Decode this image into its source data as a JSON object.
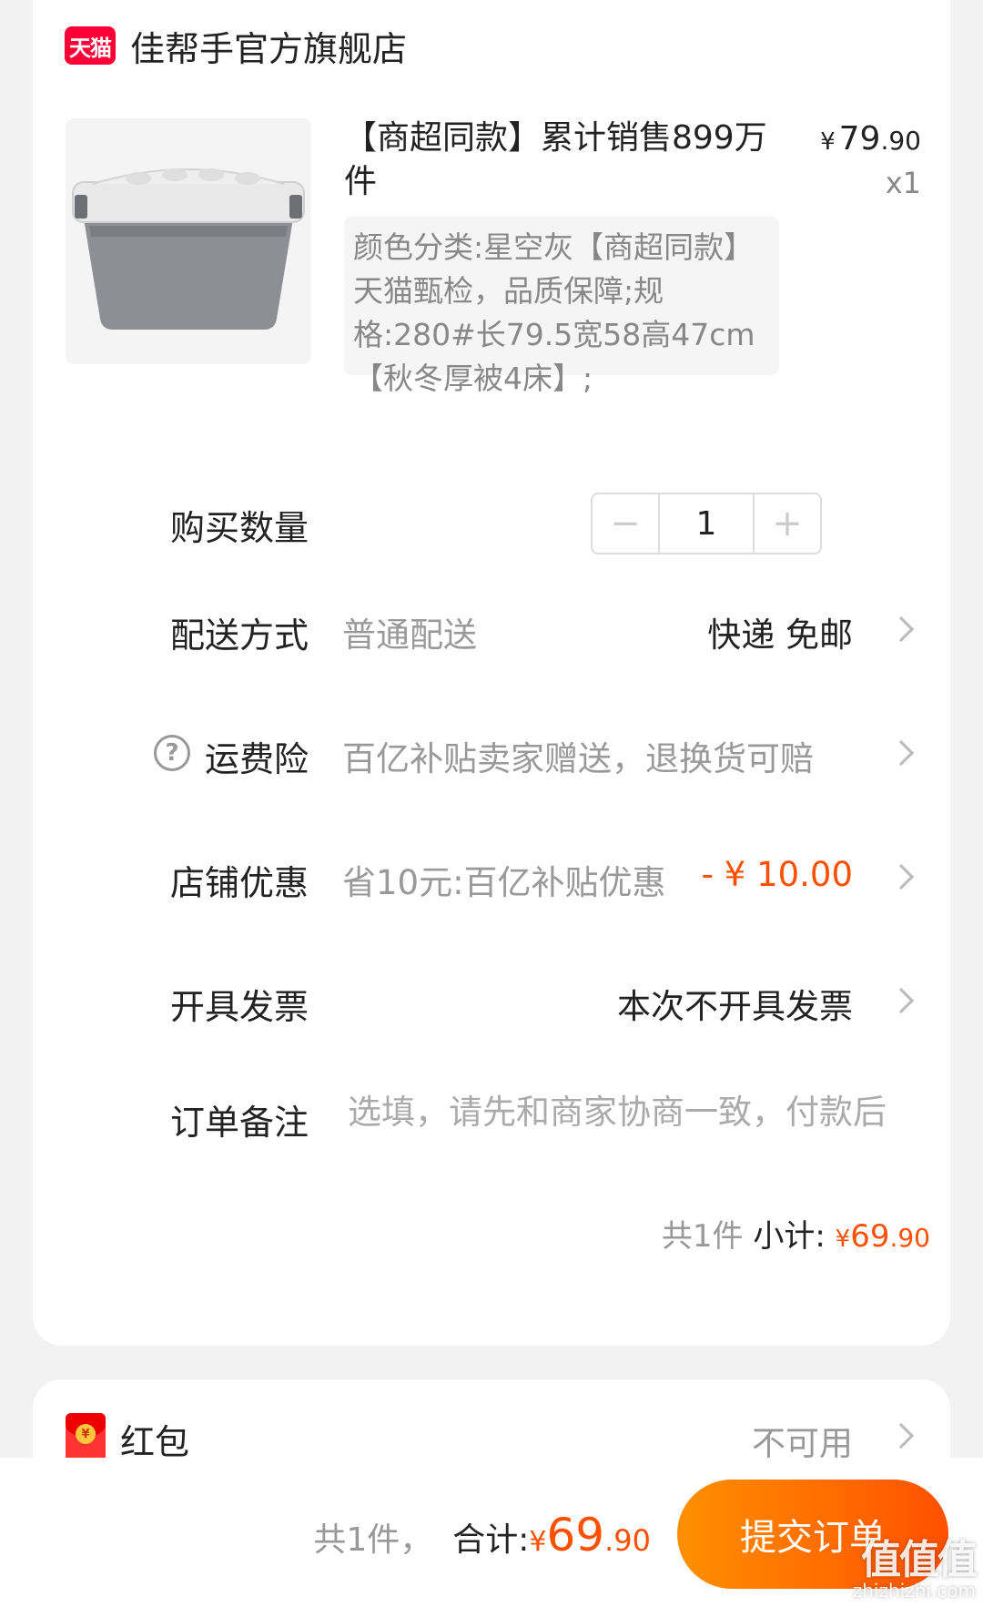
{
  "store": {
    "badge": "天猫",
    "name": "佳帮手官方旗舰店"
  },
  "product": {
    "title": "【商超同款】累计销售899万件",
    "price": {
      "symbol": "¥",
      "integer": "79",
      "decimal": ".90"
    },
    "quantity_label": "x1",
    "sku": "颜色分类:星空灰【商超同款】天猫甄检，品质保障;规格:280#长79.5宽58高47cm【秋冬厚被4床】;"
  },
  "rows": {
    "quantity": {
      "label": "购买数量",
      "value": "1",
      "minus": "−",
      "plus": "+"
    },
    "delivery": {
      "label": "配送方式",
      "sub": "普通配送",
      "value": "快递 免邮"
    },
    "insurance": {
      "label": "运费险",
      "sub": "百亿补贴卖家赠送，退换货可赔",
      "icon": "?"
    },
    "discount": {
      "label": "店铺优惠",
      "sub": "省10元:百亿补贴优惠",
      "value": "- ¥ 10.00"
    },
    "invoice": {
      "label": "开具发票",
      "value": "本次不开具发票"
    },
    "remark": {
      "label": "订单备注",
      "placeholder": "选填，请先和商家协商一致，付款后"
    }
  },
  "subtotal": {
    "count_text": "共1件",
    "label": "小计:",
    "symbol": "¥",
    "integer": "69",
    "decimal": ".90"
  },
  "redpacket": {
    "label": "红包",
    "value": "不可用",
    "coin": "¥"
  },
  "bottom": {
    "count_text": "共1件，",
    "label": "合计:",
    "symbol": "¥",
    "integer": "69",
    "decimal": ".90",
    "submit": "提交订单"
  },
  "watermark": {
    "logo": "值值值",
    "url": "zhizhizhi.com"
  },
  "colors": {
    "accent": "#ff5000",
    "tmall": "#ff0036",
    "gradient_start": "#ff9000"
  }
}
